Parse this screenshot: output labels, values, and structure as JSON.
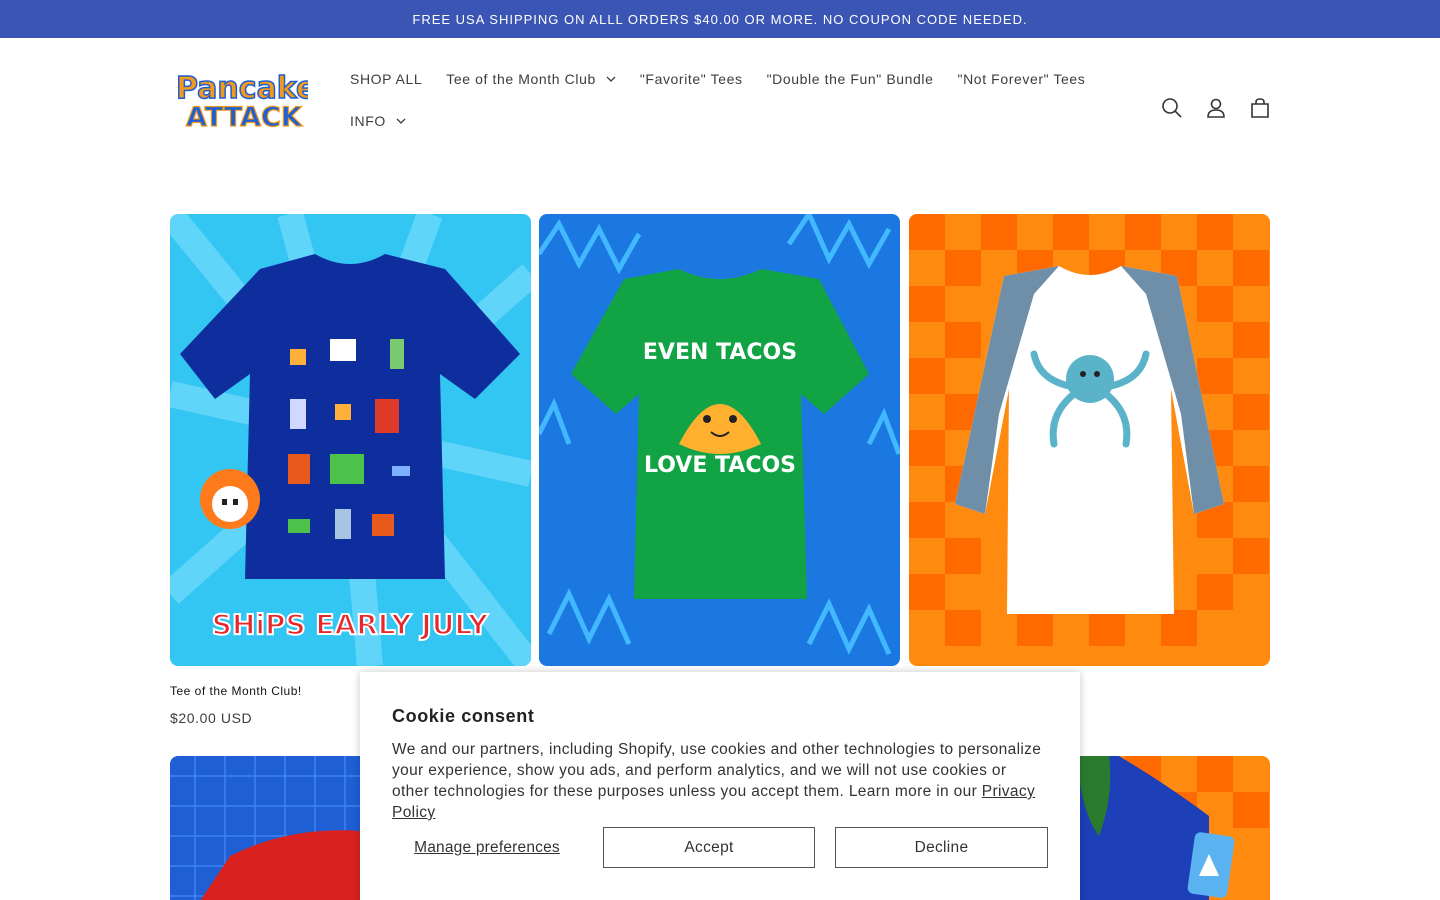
{
  "announcement": {
    "text": "FREE USA SHIPPING ON ALLL ORDERS $40.00 OR MORE. NO COUPON CODE NEEDED."
  },
  "brand": {
    "logo_line1": "Pancake",
    "logo_line2": "ATTACK"
  },
  "nav": {
    "row1": [
      {
        "label": "SHOP ALL"
      },
      {
        "label": "Tee of the Month Club"
      },
      {
        "label": "\"Favorite\" Tees"
      },
      {
        "label": "\"Double the Fun\" Bundle"
      },
      {
        "label": "\"Not Forever\" Tees"
      }
    ],
    "row2": [
      {
        "label": "INFO"
      }
    ]
  },
  "header_icons": [
    "search-icon",
    "account-icon",
    "cart-icon"
  ],
  "products": [
    {
      "title": "Tee of the Month Club!",
      "price": "$20.00 USD",
      "image_text": "SHiPS EARLY JULY",
      "bg": "#33c6f2",
      "shirt": "#0d2e9c"
    },
    {
      "title": "",
      "price": "",
      "shirt_text_top": "EVEN TACOS",
      "shirt_text_bottom": "LOVE TACOS",
      "bg": "#1a78e0",
      "shirt": "#12a344"
    },
    {
      "title": "",
      "price": "",
      "bg": "#ff8a10",
      "shirt": "#ffffff"
    }
  ],
  "cookie": {
    "title": "Cookie consent",
    "text": "We and our partners, including Shopify, use cookies and other technologies to personalize your experience, show you ads, and perform analytics, and we will not use cookies or other technologies for these purposes unless you accept them. Learn more in our",
    "link": "Privacy Policy",
    "manage": "Manage preferences",
    "accept": "Accept",
    "decline": "Decline"
  },
  "colors": {
    "announcement_bg": "#3a55b4",
    "logo_orange": "#f39a1c",
    "logo_blue": "#1f5fd1"
  }
}
